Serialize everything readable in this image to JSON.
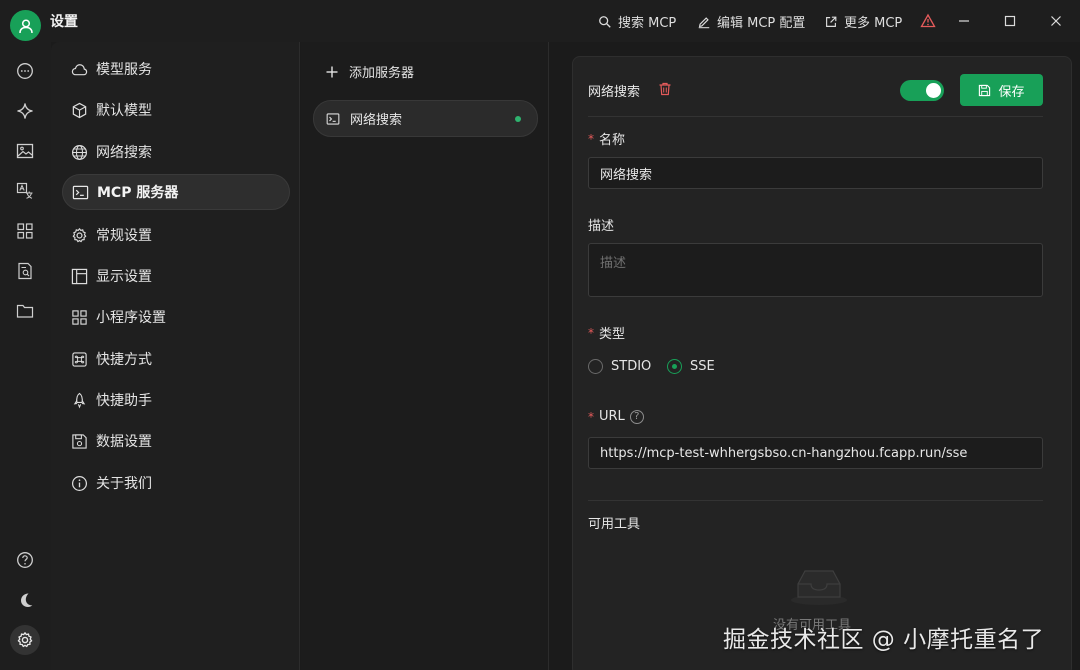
{
  "window": {
    "title": "设置",
    "actions": [
      {
        "label": "搜索 MCP",
        "icon": "search-icon"
      },
      {
        "label": "编辑 MCP 配置",
        "icon": "edit-icon"
      },
      {
        "label": "更多 MCP",
        "icon": "external-link-icon"
      }
    ]
  },
  "settings_menu": {
    "items": [
      {
        "label": "模型服务",
        "icon": "cloud-icon"
      },
      {
        "label": "默认模型",
        "icon": "cube-icon"
      },
      {
        "label": "网络搜索",
        "icon": "globe-icon"
      },
      {
        "label": "MCP 服务器",
        "icon": "terminal-icon"
      },
      {
        "label": "常规设置",
        "icon": "gear-icon"
      },
      {
        "label": "显示设置",
        "icon": "layout-icon"
      },
      {
        "label": "小程序设置",
        "icon": "grid-icon"
      },
      {
        "label": "快捷方式",
        "icon": "command-icon"
      },
      {
        "label": "快捷助手",
        "icon": "rocket-icon"
      },
      {
        "label": "数据设置",
        "icon": "save-icon"
      },
      {
        "label": "关于我们",
        "icon": "info-icon"
      }
    ],
    "active": "MCP 服务器"
  },
  "server_list": {
    "add_label": "添加服务器",
    "servers": [
      {
        "name": "网络搜索",
        "status_color": "#2fb36f"
      }
    ]
  },
  "server_form": {
    "title": "网络搜索",
    "enabled": true,
    "save_label": "保存",
    "name_label": "名称",
    "name_value": "网络搜索",
    "desc_label": "描述",
    "desc_placeholder": "描述",
    "type_label": "类型",
    "type_options": [
      "STDIO",
      "SSE"
    ],
    "type_selected": "SSE",
    "url_label": "URL",
    "url_value": "https://mcp-test-whhergsbso.cn-hangzhou.fcapp.run/sse",
    "tools_label": "可用工具",
    "tools_empty": "没有可用工具"
  },
  "watermark": "掘金技术社区 @ 小摩托重名了",
  "colors": {
    "accent": "#18a058",
    "danger": "#e55b5b",
    "background": "#1b1b1b"
  }
}
